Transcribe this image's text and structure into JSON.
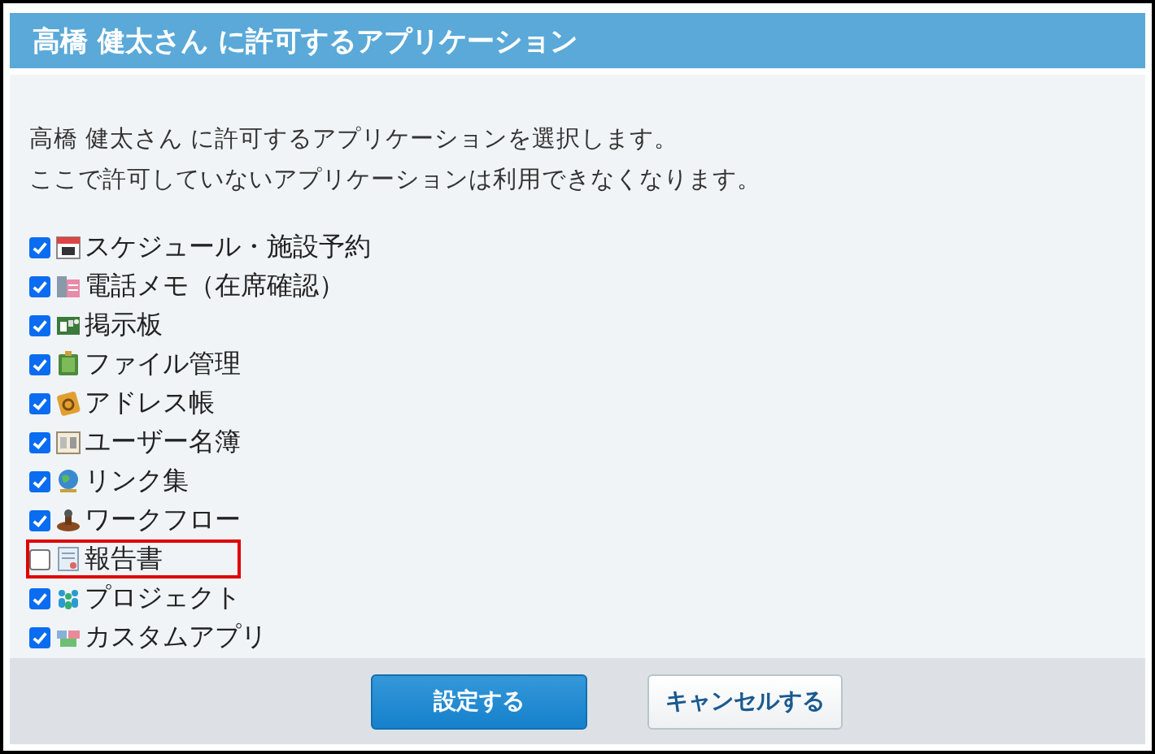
{
  "header": {
    "title": "高橋 健太さん に許可するアプリケーション"
  },
  "description": [
    "高橋 健太さん に許可するアプリケーションを選択します。",
    "ここで許可していないアプリケーションは利用できなくなります。"
  ],
  "apps": [
    {
      "label": "スケジュール・施設予約",
      "kind": "calendar",
      "checked": true,
      "highlighted": false
    },
    {
      "label": "電話メモ（在席確認）",
      "kind": "phone",
      "checked": true,
      "highlighted": false
    },
    {
      "label": "掲示板",
      "kind": "board",
      "checked": true,
      "highlighted": false
    },
    {
      "label": "ファイル管理",
      "kind": "binder",
      "checked": true,
      "highlighted": false
    },
    {
      "label": "アドレス帳",
      "kind": "addressbook",
      "checked": true,
      "highlighted": false
    },
    {
      "label": "ユーザー名簿",
      "kind": "roster",
      "checked": true,
      "highlighted": false
    },
    {
      "label": "リンク集",
      "kind": "globe",
      "checked": true,
      "highlighted": false
    },
    {
      "label": "ワークフロー",
      "kind": "stamp",
      "checked": true,
      "highlighted": false
    },
    {
      "label": "報告書",
      "kind": "report",
      "checked": false,
      "highlighted": true
    },
    {
      "label": "プロジェクト",
      "kind": "people",
      "checked": true,
      "highlighted": false
    },
    {
      "label": "カスタムアプリ",
      "kind": "blocks",
      "checked": true,
      "highlighted": false
    }
  ],
  "buttons": [
    {
      "label": "設定する",
      "kind": "primary"
    },
    {
      "label": "キャンセルする",
      "kind": "secondary"
    }
  ]
}
